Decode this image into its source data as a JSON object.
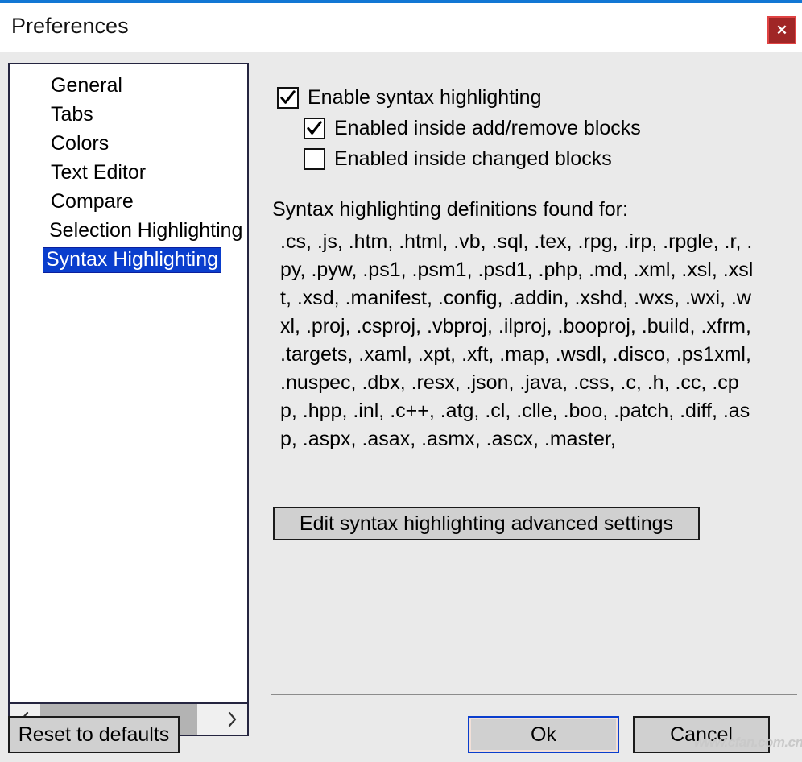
{
  "window": {
    "title": "Preferences",
    "accent_color": "#1277d4",
    "background_color": "#eaeaea",
    "close_label": "✕"
  },
  "sidebar": {
    "items": [
      {
        "label": "General",
        "selected": false
      },
      {
        "label": "Tabs",
        "selected": false
      },
      {
        "label": "Colors",
        "selected": false
      },
      {
        "label": "Text Editor",
        "selected": false
      },
      {
        "label": "Compare",
        "selected": false
      },
      {
        "label": "Selection Highlighting",
        "selected": false
      },
      {
        "label": "Syntax Highlighting",
        "selected": true
      }
    ],
    "selection_color": "#0a3ecd",
    "scrollbar": {
      "left_arrow": "‹",
      "right_arrow": "›"
    }
  },
  "main": {
    "checkboxes": [
      {
        "label": "Enable syntax highlighting",
        "checked": true,
        "indent": 0
      },
      {
        "label": "Enabled inside add/remove blocks",
        "checked": true,
        "indent": 1
      },
      {
        "label": "Enabled inside changed blocks",
        "checked": false,
        "indent": 1
      }
    ],
    "definitions_heading": "Syntax highlighting definitions found for:",
    "definitions_list": ".cs, .js, .htm, .html, .vb, .sql, .tex, .rpg, .irp, .rpgle, .r, .py, .pyw, .ps1, .psm1, .psd1, .php, .md, .xml, .xsl, .xslt, .xsd, .manifest, .config, .addin, .xshd, .wxs, .wxi, .wxl, .proj, .csproj, .vbproj, .ilproj, .booproj, .build, .xfrm, .targets, .xaml, .xpt, .xft, .map, .wsdl, .disco, .ps1xml, .nuspec, .dbx, .resx, .json, .java, .css, .c, .h, .cc, .cpp, .hpp, .inl, .c++, .atg, .cl, .clle, .boo, .patch, .diff, .asp, .aspx, .asax, .asmx, .ascx, .master,",
    "advanced_button_label": "Edit syntax highlighting advanced settings"
  },
  "footer": {
    "reset_label": "Reset to defaults",
    "ok_label": "Ok",
    "cancel_label": "Cancel"
  },
  "watermark": {
    "text": "www.cfan.com.cn"
  }
}
